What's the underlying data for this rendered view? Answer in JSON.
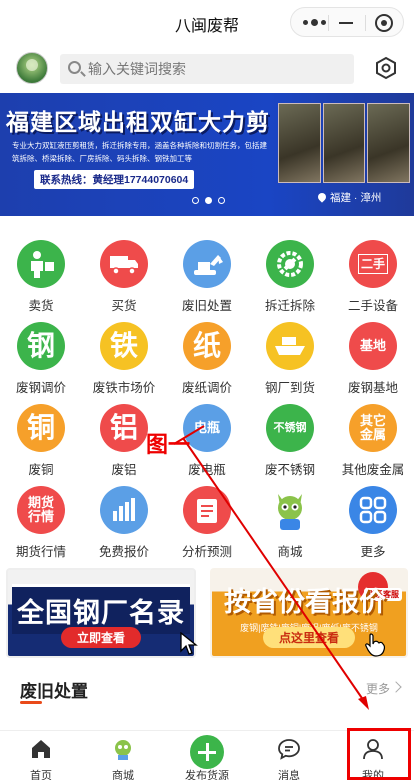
{
  "window": {
    "title": "八闽废帮"
  },
  "search": {
    "placeholder": "输入关键词搜索"
  },
  "banner": {
    "headline": "福建区域出租双缸大力剪",
    "desc": "专业大力双缸液压剪租赁，拆迁拆除专用，涵盖各种拆除和切割任务，包括建筑拆除、桥梁拆除、厂房拆除、码头拆除、钢铁加工等",
    "hotline": "联系热线：黄经理17744070604",
    "location": "福建 · 漳州",
    "slide_count": 3,
    "active_slide": 2
  },
  "grid": [
    {
      "label": "卖货",
      "glyph": "",
      "icon": "person-with-goods-icon",
      "color": "#3cb44b"
    },
    {
      "label": "买货",
      "glyph": "",
      "icon": "truck-icon",
      "color": "#ef4b4b"
    },
    {
      "label": "废旧处置",
      "glyph": "",
      "icon": "excavator-icon",
      "color": "#5b9fe6"
    },
    {
      "label": "拆迁拆除",
      "glyph": "",
      "icon": "wrench-gear-icon",
      "color": "#3cb44b"
    },
    {
      "label": "二手设备",
      "glyph": "二手",
      "icon": "second-hand-icon",
      "color": "#ef4b4b"
    },
    {
      "label": "废钢调价",
      "glyph": "钢",
      "icon": "steel-icon",
      "color": "#3cb44b"
    },
    {
      "label": "废铁市场价",
      "glyph": "铁",
      "icon": "iron-icon",
      "color": "#f6c223"
    },
    {
      "label": "废纸调价",
      "glyph": "纸",
      "icon": "paper-icon",
      "color": "#f6a02a"
    },
    {
      "label": "钢厂到货",
      "glyph": "",
      "icon": "ship-icon",
      "color": "#f6c223"
    },
    {
      "label": "废钢基地",
      "glyph": "基地",
      "icon": "base-icon",
      "color": "#ef4b4b"
    },
    {
      "label": "废铜",
      "glyph": "铜",
      "icon": "copper-icon",
      "color": "#f6a02a"
    },
    {
      "label": "废铝",
      "glyph": "铝",
      "icon": "aluminum-icon",
      "color": "#ef4b4b"
    },
    {
      "label": "废电瓶",
      "glyph": "电瓶",
      "icon": "battery-icon",
      "color": "#5b9fe6"
    },
    {
      "label": "废不锈钢",
      "glyph": "不锈钢",
      "icon": "stainless-steel-icon",
      "color": "#3cb44b"
    },
    {
      "label": "其他废金属",
      "glyph": "其它金属",
      "icon": "other-metal-icon",
      "color": "#f6a02a"
    },
    {
      "label": "期货行情",
      "glyph": "期货行情",
      "icon": "futures-icon",
      "color": "#ef4b4b"
    },
    {
      "label": "免费报价",
      "glyph": "",
      "icon": "bar-chart-icon",
      "color": "#5b9fe6"
    },
    {
      "label": "分析预测",
      "glyph": "",
      "icon": "notepad-icon",
      "color": "#ef4b4b"
    },
    {
      "label": "商城",
      "glyph": "",
      "icon": "mascot-icon",
      "color": "#ffffff"
    },
    {
      "label": "更多",
      "glyph": "",
      "icon": "grid-icon",
      "color": "#3a86e6"
    }
  ],
  "promo": {
    "left": {
      "title": "全国钢厂名录",
      "button": "立即查看"
    },
    "right": {
      "title": "按省份看报价",
      "subtitle": "废钢|废铁|废铜|废铝|废纸|废不锈钢",
      "button": "点这里查看",
      "tag": "联系客服"
    }
  },
  "section": {
    "title": "废旧处置",
    "more": "更多"
  },
  "tabbar": [
    {
      "label": "首页",
      "icon": "home-icon"
    },
    {
      "label": "商城",
      "icon": "mascot-icon"
    },
    {
      "label": "发布货源",
      "icon": "plus-icon"
    },
    {
      "label": "消息",
      "icon": "message-icon"
    },
    {
      "label": "我的",
      "icon": "user-icon"
    }
  ],
  "annotation": {
    "label": "图一",
    "color": "#e00000"
  }
}
